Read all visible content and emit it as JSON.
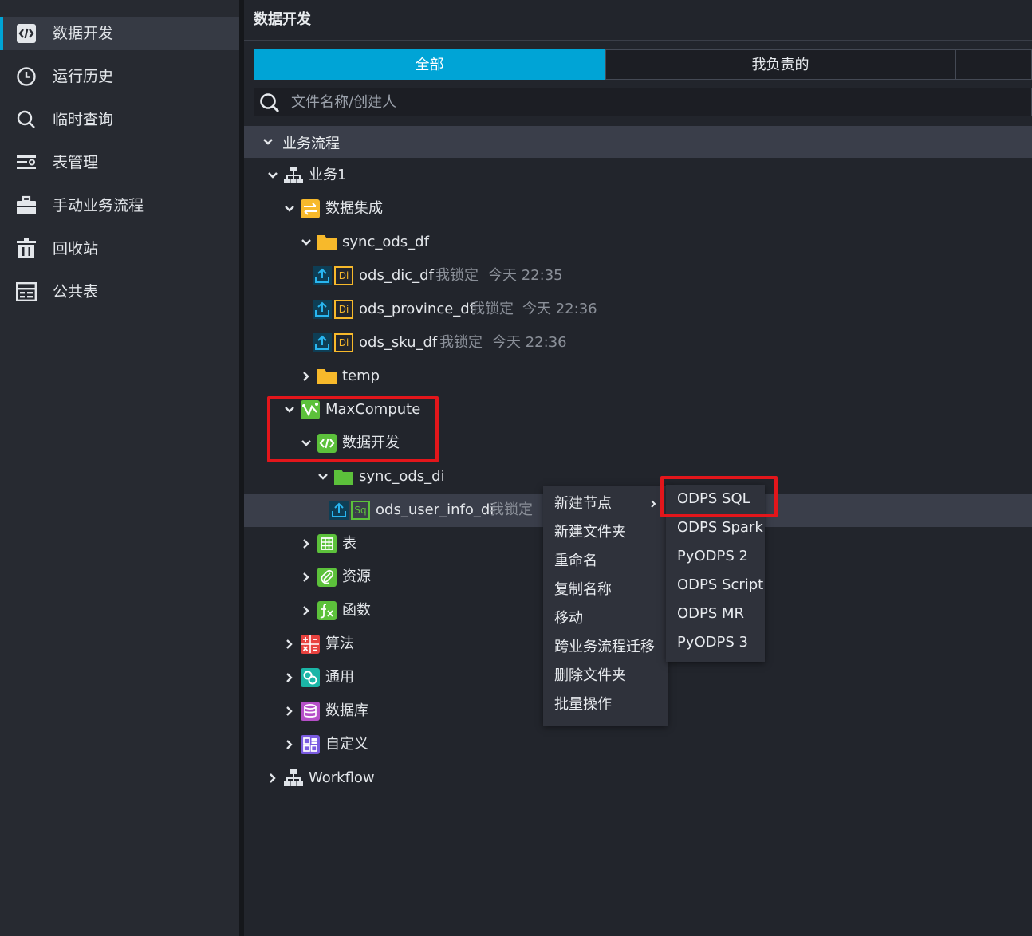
{
  "sidebar": {
    "items": [
      {
        "label": "数据开发",
        "icon": "code-icon",
        "active": true
      },
      {
        "label": "运行历史",
        "icon": "history-icon"
      },
      {
        "label": "临时查询",
        "icon": "search-icon"
      },
      {
        "label": "表管理",
        "icon": "table-manage-icon"
      },
      {
        "label": "手动业务流程",
        "icon": "briefcase-icon"
      },
      {
        "label": "回收站",
        "icon": "trash-icon"
      },
      {
        "label": "公共表",
        "icon": "public-table-icon"
      }
    ]
  },
  "panel": {
    "title": "数据开发",
    "tabs": [
      {
        "label": "全部",
        "active": true
      },
      {
        "label": "我负责的"
      },
      {
        "label": ""
      }
    ],
    "search_placeholder": "文件名称/创建人",
    "section": "业务流程"
  },
  "tree": {
    "biz1": "业务1",
    "data_integration": "数据集成",
    "sync_ods_df": "sync_ods_df",
    "nodes_df": [
      {
        "name": "ods_dic_df",
        "lock": "我锁定",
        "time": "今天 22:35"
      },
      {
        "name": "ods_province_df",
        "lock": "我锁定",
        "time": "今天 22:36"
      },
      {
        "name": "ods_sku_df",
        "lock": "我锁定",
        "time": "今天 22:36"
      }
    ],
    "temp": "temp",
    "maxcompute": "MaxCompute",
    "data_dev": "数据开发",
    "sync_ods_di": "sync_ods_di",
    "node_di": {
      "name": "ods_user_info_di",
      "lock": "我锁定"
    },
    "table": "表",
    "resource": "资源",
    "function": "函数",
    "algorithm": "算法",
    "general": "通用",
    "database": "数据库",
    "custom": "自定义",
    "workflow": "Workflow",
    "badge_di": "Di",
    "badge_sq": "Sq"
  },
  "context_menu": {
    "items": [
      "新建节点",
      "新建文件夹",
      "重命名",
      "复制名称",
      "移动",
      "跨业务流程迁移",
      "删除文件夹",
      "批量操作"
    ]
  },
  "submenu": {
    "items": [
      "ODPS SQL",
      "ODPS Spark",
      "PyODPS 2",
      "ODPS Script",
      "ODPS MR",
      "PyODPS 3"
    ]
  },
  "colors": {
    "accent": "#00a4d6",
    "annotation": "#e3161b",
    "folder_yellow": "#f7b92b",
    "folder_green": "#5cc13b"
  }
}
